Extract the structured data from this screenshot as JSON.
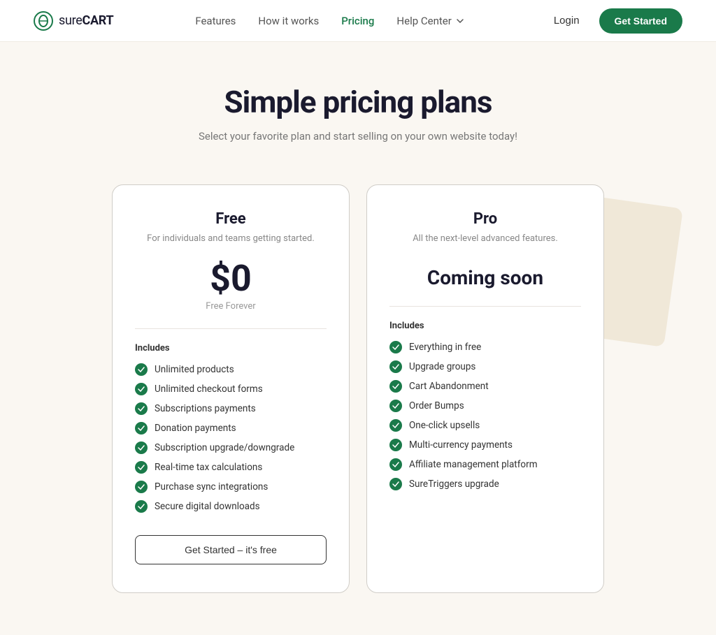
{
  "nav": {
    "logo_text_sure": "sure",
    "logo_text_cart": "CART",
    "links": [
      {
        "label": "Features",
        "active": false
      },
      {
        "label": "How it works",
        "active": false
      },
      {
        "label": "Pricing",
        "active": true
      },
      {
        "label": "Help Center",
        "active": false,
        "has_dropdown": true
      },
      {
        "label": "Login",
        "active": false
      }
    ],
    "cta_label": "Get Started"
  },
  "hero": {
    "title": "Simple pricing plans",
    "subtitle": "Select your favorite plan and start selling on your own website today!"
  },
  "pricing": {
    "cards": [
      {
        "id": "free",
        "title": "Free",
        "subtitle": "For individuals and teams getting started.",
        "price": "$0",
        "price_label": "Free Forever",
        "includes_label": "Includes",
        "features": [
          "Unlimited products",
          "Unlimited checkout forms",
          "Subscriptions payments",
          "Donation payments",
          "Subscription upgrade/downgrade",
          "Real-time tax calculations",
          "Purchase sync integrations",
          "Secure digital downloads"
        ],
        "cta_label": "Get Started – it's free"
      },
      {
        "id": "pro",
        "title": "Pro",
        "subtitle": "All the next-level advanced features.",
        "coming_soon": "Coming soon",
        "includes_label": "Includes",
        "features": [
          "Everything in free",
          "Upgrade groups",
          "Cart Abandonment",
          "Order Bumps",
          "One-click upsells",
          "Multi-currency payments",
          "Affiliate management platform",
          "SureTriggers upgrade"
        ]
      }
    ]
  }
}
